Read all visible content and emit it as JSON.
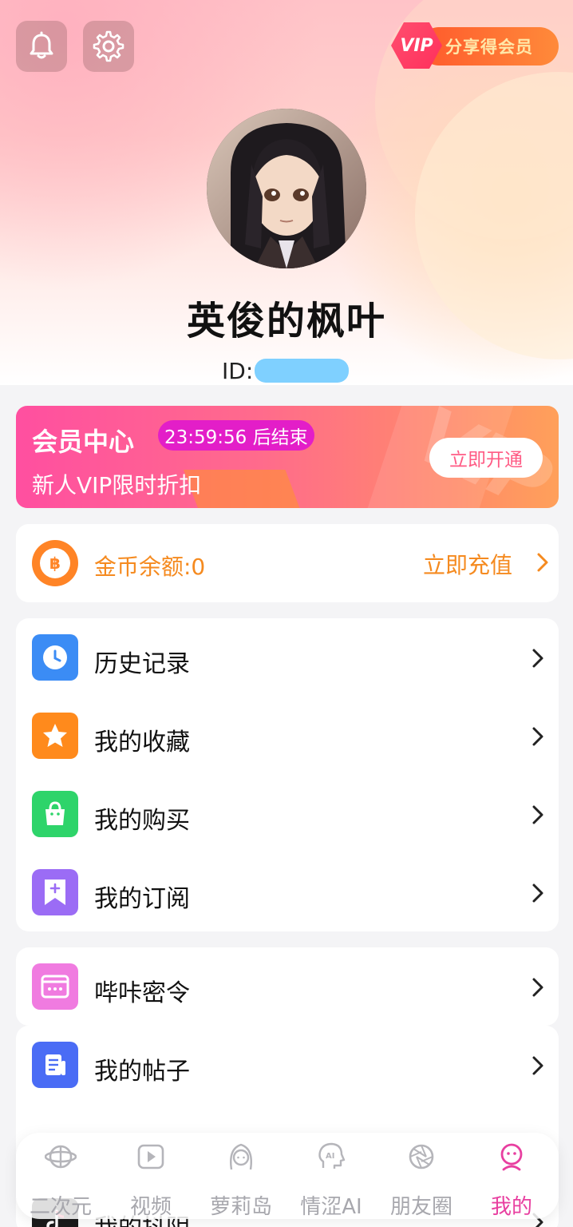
{
  "header": {
    "vip_badge": "VIP",
    "vip_share_label": "分享得会员",
    "username": "英俊的枫叶",
    "id_label": "ID:"
  },
  "vip_banner": {
    "title": "会员中心",
    "countdown": "23:59:56 后结束",
    "subtitle": "新人VIP限时折扣",
    "watermark": "VIP",
    "button": "立即开通"
  },
  "coins": {
    "icon_symbol": "฿",
    "balance_label": "金币余额:0",
    "recharge_label": "立即充值"
  },
  "menu": {
    "items": [
      {
        "label": "历史记录",
        "icon": "clock-icon",
        "color": "#3b8cf5"
      },
      {
        "label": "我的收藏",
        "icon": "star-icon",
        "color": "#ff8a1c"
      },
      {
        "label": "我的购买",
        "icon": "shopping-bag-icon",
        "color": "#2ed46a"
      },
      {
        "label": "我的订阅",
        "icon": "bookmark-plus-icon",
        "color": "#9b6cf5"
      },
      {
        "label": "哔咔密令",
        "icon": "password-card-icon",
        "color": "#f07be0"
      },
      {
        "label": "我的帖子",
        "icon": "document-icon",
        "color": "#4a6cf5"
      },
      {
        "label": "我的抖阴",
        "icon": "tiktok-icon",
        "color": "#1a1a1a"
      }
    ]
  },
  "tabbar": {
    "tabs": [
      {
        "label": "二次元",
        "icon": "planet-icon",
        "active": false
      },
      {
        "label": "视频",
        "icon": "play-icon",
        "active": false
      },
      {
        "label": "萝莉岛",
        "icon": "girl-face-icon",
        "active": false
      },
      {
        "label": "情涩AI",
        "icon": "ai-head-icon",
        "active": false
      },
      {
        "label": "朋友圈",
        "icon": "aperture-icon",
        "active": false
      },
      {
        "label": "我的",
        "icon": "profile-bear-icon",
        "active": true
      }
    ]
  },
  "colors": {
    "accent_pink": "#e83fa0",
    "coin_orange": "#f58a1f"
  }
}
